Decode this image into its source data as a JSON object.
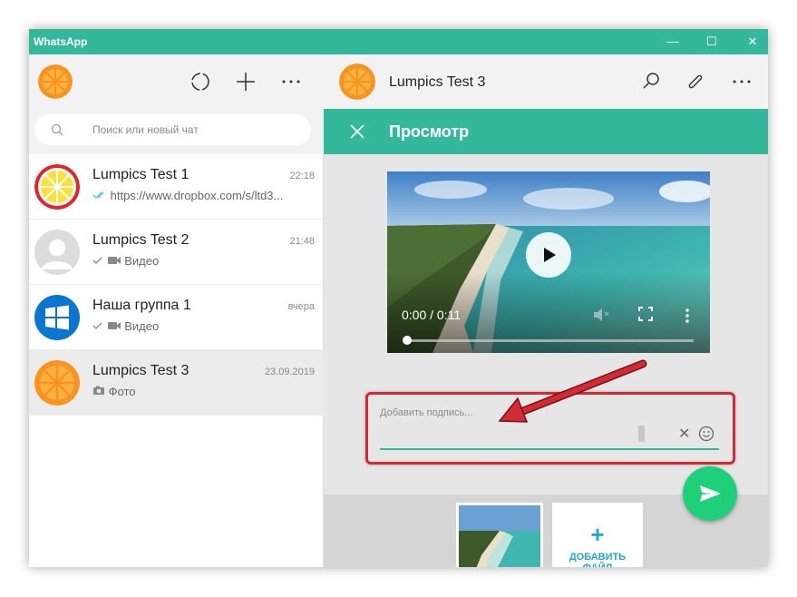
{
  "window": {
    "title": "WhatsApp"
  },
  "sidebar": {
    "search_placeholder": "Поиск или новый чат",
    "chats": [
      {
        "name": "Lumpics Test 1",
        "time": "22:18",
        "preview": "https://www.dropbox.com/s/ltd3...",
        "status_icon": "double-check-icon",
        "avatar": "orange-red-ring"
      },
      {
        "name": "Lumpics Test 2",
        "time": "21:48",
        "preview": "Видео",
        "status_icon": "check-icon",
        "media_icon": "video-icon",
        "avatar": "default-user"
      },
      {
        "name": "Наша группа 1",
        "time": "вчера",
        "preview": "Видео",
        "status_icon": "check-icon",
        "media_icon": "video-icon",
        "avatar": "windows-logo"
      },
      {
        "name": "Lumpics Test 3",
        "time": "23.09.2019",
        "preview": "Фото",
        "media_icon": "camera-icon",
        "avatar": "orange"
      }
    ]
  },
  "main": {
    "contact_name": "Lumpics Test 3",
    "preview_title": "Просмотр",
    "video_time": "0:00 / 0:11",
    "caption_placeholder": "Добавить подпись...",
    "add_file_label": "ДОБАВИТЬ ФАЙЛ"
  },
  "colors": {
    "accent": "#34b89b",
    "send": "#1fd07a",
    "highlight": "#d12b35",
    "link": "#1ea5d9"
  }
}
